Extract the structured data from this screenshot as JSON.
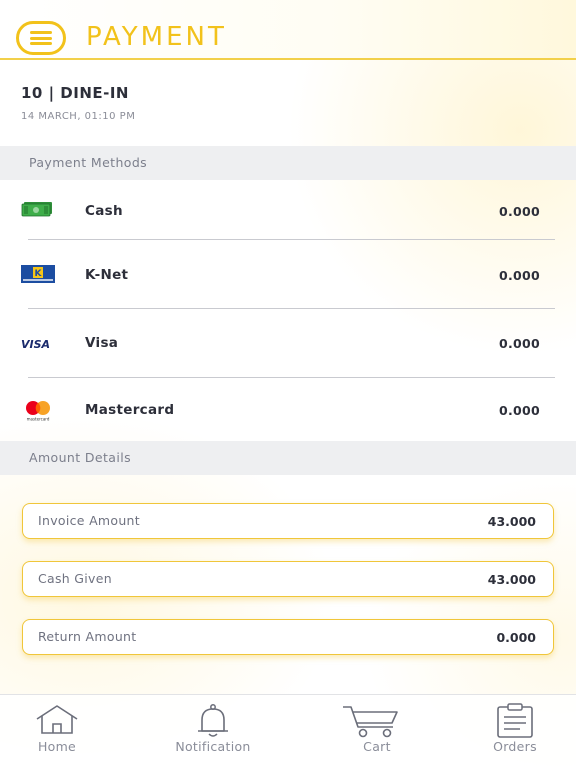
{
  "header": {
    "title": "PAYMENT",
    "menu_icon": "hamburger-menu-icon",
    "accent_color": "#f2c21b"
  },
  "order": {
    "title": "10 | DINE-IN",
    "date": "14 MARCH, 01:10 PM"
  },
  "payment_methods": {
    "section_label": "Payment Methods",
    "items": [
      {
        "label": "Cash",
        "value": "0.000",
        "icon": "cash-icon"
      },
      {
        "label": "K-Net",
        "value": "0.000",
        "icon": "knet-icon"
      },
      {
        "label": "Visa",
        "value": "0.000",
        "icon": "visa-icon",
        "icon_text": "VISA"
      },
      {
        "label": "Mastercard",
        "value": "0.000",
        "icon": "mastercard-icon",
        "icon_text": "mastercard"
      }
    ]
  },
  "amount_details": {
    "section_label": "Amount Details",
    "items": [
      {
        "label": "Invoice Amount",
        "value": "43.000"
      },
      {
        "label": "Cash Given",
        "value": "43.000"
      },
      {
        "label": "Return Amount",
        "value": "0.000"
      }
    ]
  },
  "bottom_nav": {
    "items": [
      {
        "label": "Home",
        "icon": "home-icon"
      },
      {
        "label": "Notification",
        "icon": "bell-icon"
      },
      {
        "label": "Cart",
        "icon": "cart-icon"
      },
      {
        "label": "Orders",
        "icon": "clipboard-icon"
      }
    ]
  }
}
